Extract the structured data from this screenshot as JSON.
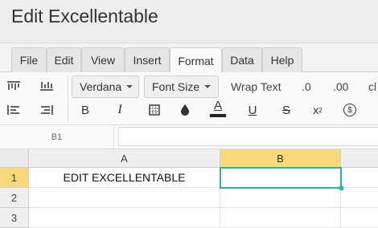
{
  "title": "Edit Excellentable",
  "menu": {
    "tabs": [
      {
        "label": "File",
        "active": false
      },
      {
        "label": "Edit",
        "active": false
      },
      {
        "label": "View",
        "active": false
      },
      {
        "label": "Insert",
        "active": false
      },
      {
        "label": "Format",
        "active": true
      },
      {
        "label": "Data",
        "active": false
      },
      {
        "label": "Help",
        "active": false
      }
    ]
  },
  "toolbar": {
    "font_family": "Verdana",
    "font_size": "Font Size",
    "wrap_text": "Wrap Text",
    "decimal_decrease": ".0",
    "decimal_increase": ".00",
    "clear_partial": "cl",
    "bold": "B",
    "italic": "I",
    "text_color_glyph": "A",
    "underline": "U",
    "strikethrough": "S",
    "superscript_base": "x",
    "superscript_exp": "2",
    "currency": "$",
    "accent_color": "#27b79a",
    "text_color_bar": "#222222"
  },
  "formula_bar": {
    "cell_ref": "B1",
    "value": ""
  },
  "grid": {
    "columns": [
      "A",
      "B"
    ],
    "selected_column": "B",
    "rows": [
      "1",
      "2",
      "3"
    ],
    "selected_row": "1",
    "cells": {
      "A1": "EDIT EXCELLENTABLE",
      "B1": "",
      "A2": "",
      "B2": "",
      "A3": "",
      "B3": ""
    },
    "selection_color": "#27b79a",
    "header_highlight": "#f7d87a"
  }
}
